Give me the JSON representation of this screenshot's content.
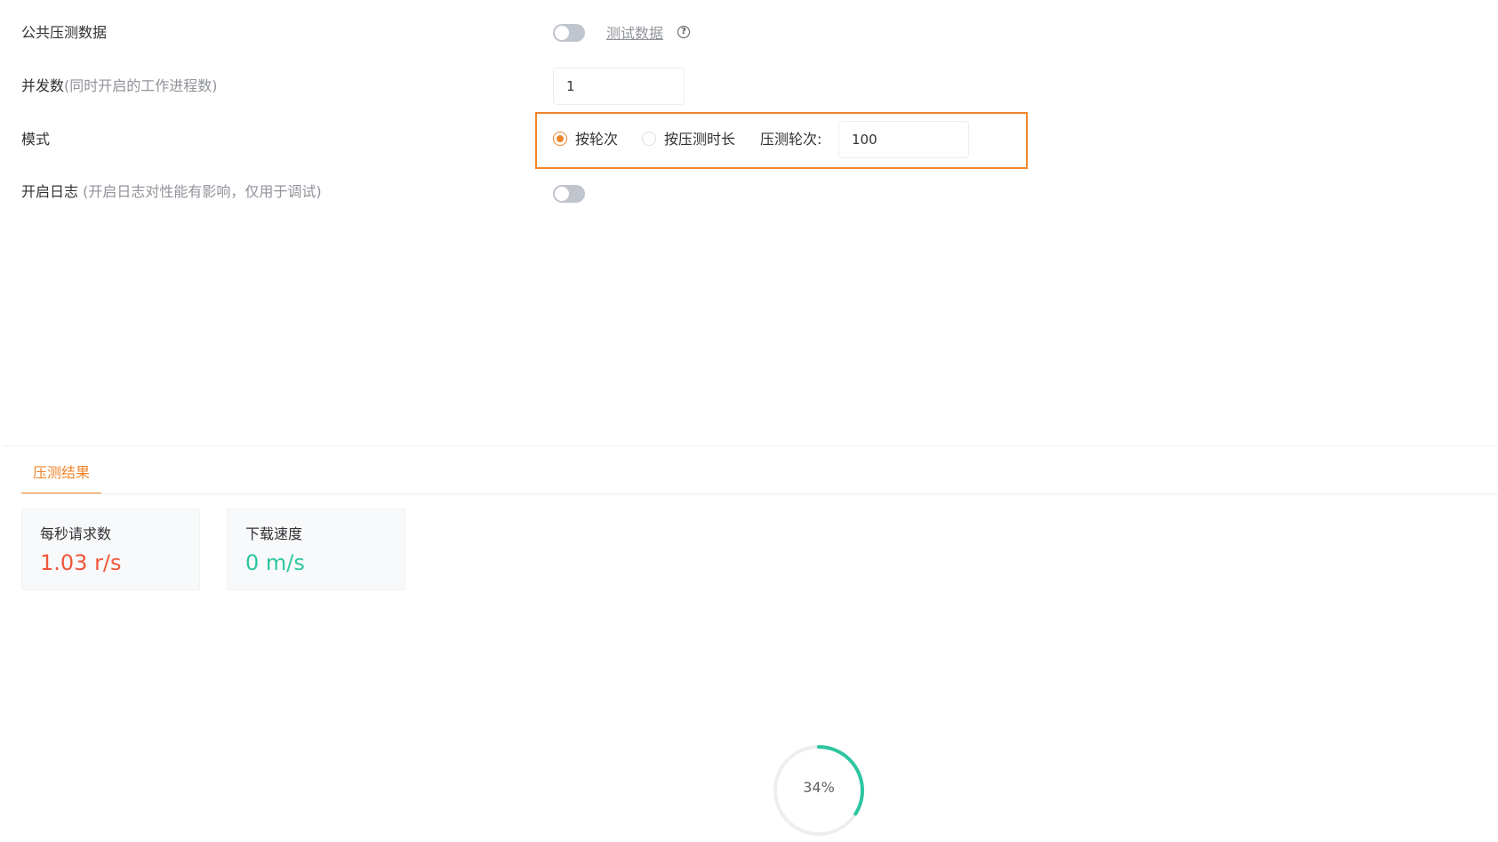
{
  "form": {
    "public_data": {
      "label": "公共压测数据",
      "toggle_on": false,
      "link": "测试数据",
      "help": "?"
    },
    "concurrency": {
      "label": "并发数",
      "hint": "(同时开启的工作进程数)",
      "value": "1"
    },
    "mode": {
      "label": "模式",
      "options": [
        {
          "label": "按轮次",
          "checked": true
        },
        {
          "label": "按压测时长",
          "checked": false
        }
      ],
      "rounds_label": "压测轮次:",
      "rounds_value": "100"
    },
    "log": {
      "label": "开启日志",
      "hint": " (开启日志对性能有影响，仅用于调试)",
      "toggle_on": false
    }
  },
  "results": {
    "tab_label": "压测结果",
    "cards": [
      {
        "title": "每秒请求数",
        "value": "1.03 r/s",
        "color": "#f0573a"
      },
      {
        "title": "下载速度",
        "value": "0 m/s",
        "color": "#2dc6a0"
      }
    ],
    "progress": {
      "percent": 34,
      "label": "34%",
      "color": "#2dc6a0",
      "track_color": "#eeeeee"
    }
  },
  "colors": {
    "accent": "#f0852a"
  }
}
